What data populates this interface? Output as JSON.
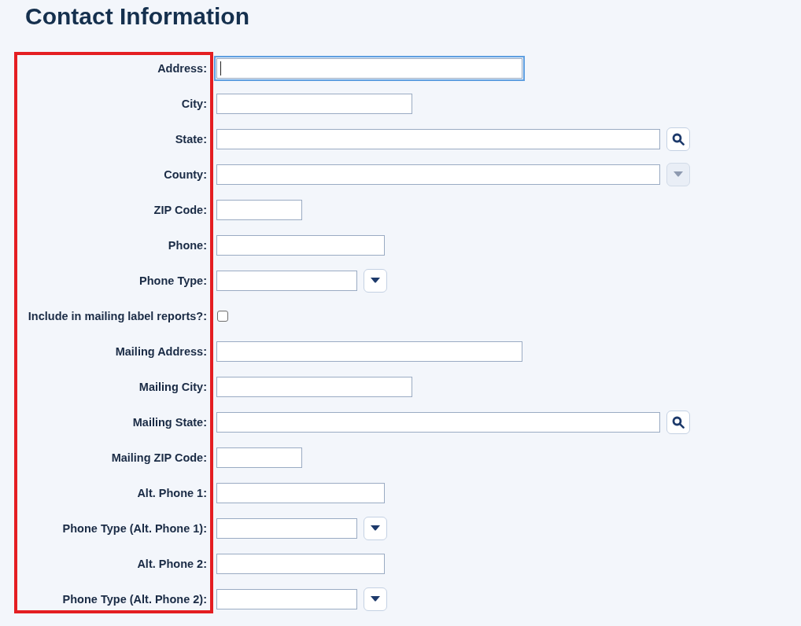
{
  "title": "Contact Information",
  "fields": [
    {
      "label": "Address:",
      "kind": "text",
      "focused": true
    },
    {
      "label": "City:",
      "kind": "text",
      "focused": false
    },
    {
      "label": "State:",
      "kind": "lookup",
      "focused": false,
      "button_disabled": false
    },
    {
      "label": "County:",
      "kind": "select",
      "focused": false,
      "button_disabled": true
    },
    {
      "label": "ZIP Code:",
      "kind": "text",
      "focused": false
    },
    {
      "label": "Phone:",
      "kind": "text",
      "focused": false
    },
    {
      "label": "Phone Type:",
      "kind": "select",
      "focused": false,
      "button_disabled": false
    },
    {
      "label": "Include in mailing label reports?:",
      "kind": "checkbox",
      "focused": false,
      "checked": false
    },
    {
      "label": "Mailing Address:",
      "kind": "text",
      "focused": false
    },
    {
      "label": "Mailing City:",
      "kind": "text",
      "focused": false
    },
    {
      "label": "Mailing State:",
      "kind": "lookup",
      "focused": false,
      "button_disabled": false
    },
    {
      "label": "Mailing ZIP Code:",
      "kind": "text",
      "focused": false
    },
    {
      "label": "Alt. Phone 1:",
      "kind": "text",
      "focused": false
    },
    {
      "label": "Phone Type (Alt. Phone 1):",
      "kind": "select",
      "focused": false,
      "button_disabled": false
    },
    {
      "label": "Alt. Phone 2:",
      "kind": "text",
      "focused": false
    },
    {
      "label": "Phone Type (Alt. Phone 2):",
      "kind": "select",
      "focused": false,
      "button_disabled": false
    }
  ]
}
